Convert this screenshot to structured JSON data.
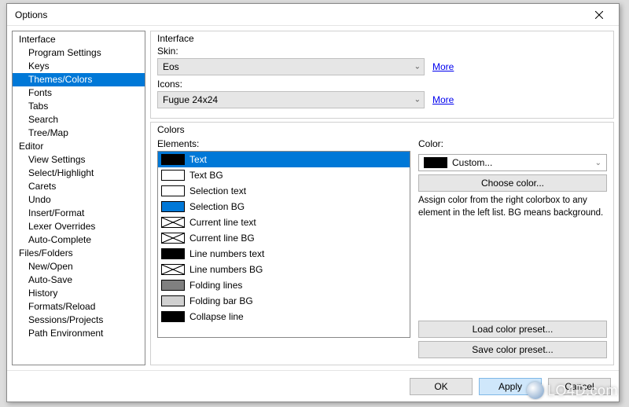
{
  "window": {
    "title": "Options"
  },
  "tree": {
    "items": [
      {
        "label": "Interface",
        "level": 0
      },
      {
        "label": "Program Settings",
        "level": 1
      },
      {
        "label": "Keys",
        "level": 1
      },
      {
        "label": "Themes/Colors",
        "level": 1,
        "selected": true
      },
      {
        "label": "Fonts",
        "level": 1
      },
      {
        "label": "Tabs",
        "level": 1
      },
      {
        "label": "Search",
        "level": 1
      },
      {
        "label": "Tree/Map",
        "level": 1
      },
      {
        "label": "Editor",
        "level": 0
      },
      {
        "label": "View Settings",
        "level": 1
      },
      {
        "label": "Select/Highlight",
        "level": 1
      },
      {
        "label": "Carets",
        "level": 1
      },
      {
        "label": "Undo",
        "level": 1
      },
      {
        "label": "Insert/Format",
        "level": 1
      },
      {
        "label": "Lexer Overrides",
        "level": 1
      },
      {
        "label": "Auto-Complete",
        "level": 1
      },
      {
        "label": "Files/Folders",
        "level": 0
      },
      {
        "label": "New/Open",
        "level": 1
      },
      {
        "label": "Auto-Save",
        "level": 1
      },
      {
        "label": "History",
        "level": 1
      },
      {
        "label": "Formats/Reload",
        "level": 1
      },
      {
        "label": "Sessions/Projects",
        "level": 1
      },
      {
        "label": "Path Environment",
        "level": 1
      }
    ]
  },
  "interface": {
    "group_title": "Interface",
    "skin_label": "Skin:",
    "skin_value": "Eos",
    "icons_label": "Icons:",
    "icons_value": "Fugue 24x24",
    "more_link": "More"
  },
  "colors": {
    "group_title": "Colors",
    "elements_label": "Elements:",
    "color_label": "Color:",
    "color_value": "Custom...",
    "choose_btn": "Choose color...",
    "description": "Assign color from the right colorbox to any element in the left list. BG means background.",
    "load_preset": "Load color preset...",
    "save_preset": "Save color preset...",
    "elements": [
      {
        "label": "Text",
        "swatch": "black",
        "selected": true
      },
      {
        "label": "Text BG",
        "swatch": "white"
      },
      {
        "label": "Selection text",
        "swatch": "white"
      },
      {
        "label": "Selection BG",
        "swatch": "blue"
      },
      {
        "label": "Current line text",
        "swatch": "cross"
      },
      {
        "label": "Current line BG",
        "swatch": "cross"
      },
      {
        "label": "Line numbers text",
        "swatch": "black"
      },
      {
        "label": "Line numbers BG",
        "swatch": "cross"
      },
      {
        "label": "Folding lines",
        "swatch": "gray"
      },
      {
        "label": "Folding bar BG",
        "swatch": "lgray"
      },
      {
        "label": "Collapse line",
        "swatch": "black"
      }
    ]
  },
  "footer": {
    "ok": "OK",
    "apply": "Apply",
    "cancel": "Cancel"
  },
  "watermark": "LO4D.com"
}
